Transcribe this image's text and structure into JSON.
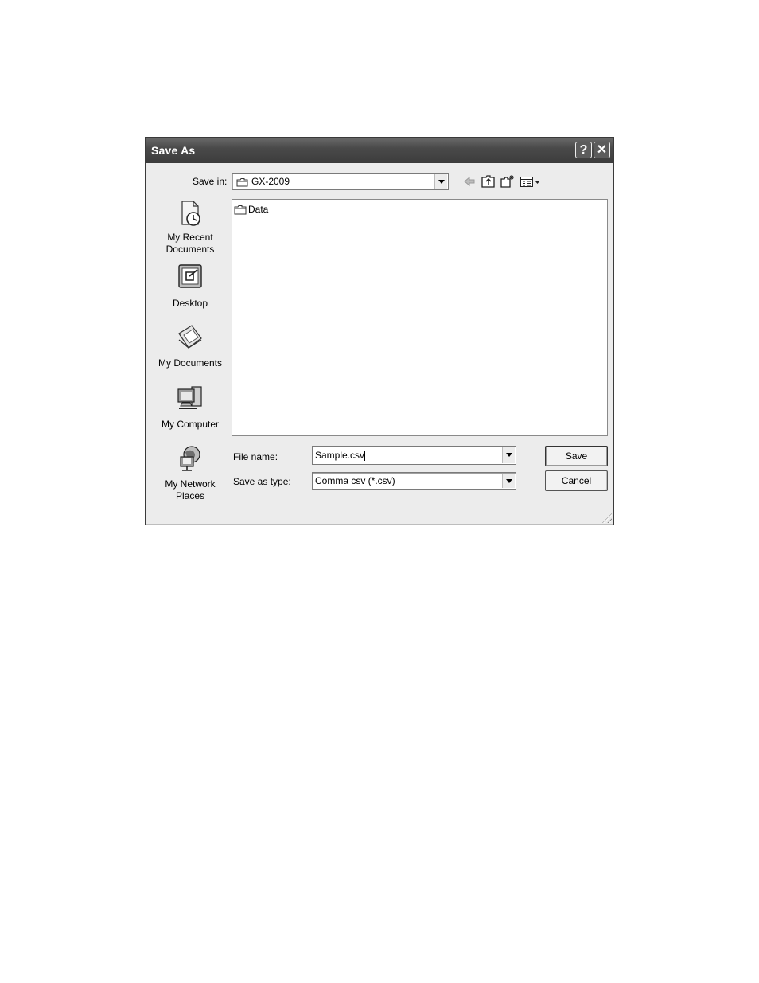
{
  "dialog": {
    "title": "Save As",
    "help_glyph": "?",
    "close_glyph": "✕"
  },
  "toolbar": {
    "save_in_label": "Save in:",
    "save_in_value": "GX-2009",
    "icons": [
      "back-arrow-icon",
      "up-folder-icon",
      "new-folder-icon",
      "views-menu-icon"
    ]
  },
  "places": [
    {
      "label": "My Recent Documents",
      "icon": "recent-documents-icon"
    },
    {
      "label": "Desktop",
      "icon": "desktop-icon"
    },
    {
      "label": "My Documents",
      "icon": "my-documents-icon"
    },
    {
      "label": "My Computer",
      "icon": "my-computer-icon"
    },
    {
      "label": "My Network Places",
      "icon": "network-places-icon"
    }
  ],
  "files": [
    {
      "name": "Data",
      "icon": "folder-icon"
    }
  ],
  "form": {
    "file_name_label": "File name:",
    "file_name_value": "Sample.csv",
    "type_label": "Save as type:",
    "type_value": "Comma csv (*.csv)"
  },
  "buttons": {
    "save": "Save",
    "cancel": "Cancel"
  }
}
